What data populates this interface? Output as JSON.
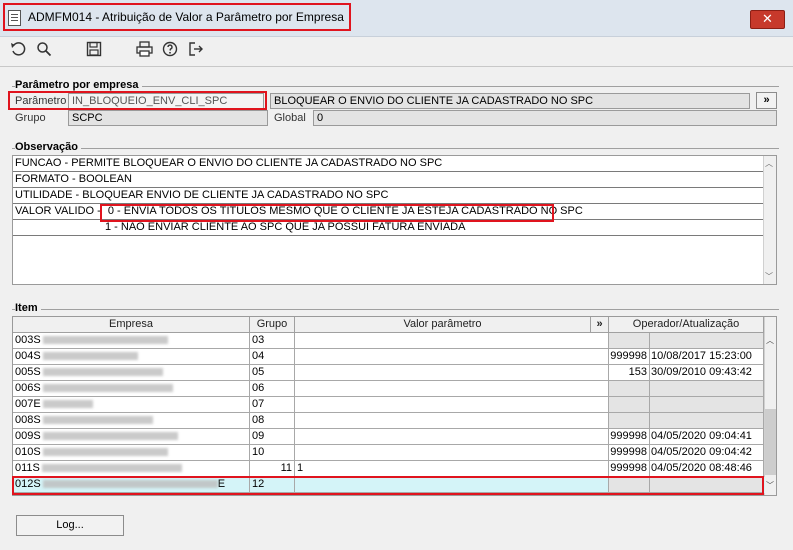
{
  "window": {
    "title": "ADMFM014 - Atribuição de Valor a Parâmetro por Empresa",
    "close_glyph": "✕"
  },
  "toolbar": {
    "icons": [
      "undo-icon",
      "search-icon",
      "save-icon",
      "print-icon",
      "help-icon",
      "exit-icon"
    ]
  },
  "parametro_group": {
    "title": "Parâmetro por empresa",
    "parametro_label": "Parâmetro",
    "parametro_value": "IN_BLOQUEIO_ENV_CLI_SPC",
    "descricao_value": "BLOQUEAR O ENVIO DO CLIENTE JA CADASTRADO NO SPC",
    "more_label": "»",
    "grupo_label": "Grupo",
    "grupo_value": "SCPC",
    "global_label": "Global",
    "global_value": "0"
  },
  "observacao_group": {
    "title": "Observação",
    "lines": [
      "FUNCAO - PERMITE BLOQUEAR O ENVIO DO CLIENTE JA CADASTRADO NO SPC",
      "FORMATO - BOOLEAN",
      "UTILIDADE - BLOQUEAR ENVIO DE CLIENTE JA CADASTRADO NO SPC",
      "VALOR VALIDO -",
      "1 - NAO ENVIAR CLIENTE AO SPC QUE JA POSSUI FATURA ENVIADA"
    ],
    "valor_valido_highlight": "0 - ENVIA TODOS OS TITULOS MESMO QUE O CLIENTE JA ESTEJA CADASTRADO NO SPC"
  },
  "item_group": {
    "title": "Item",
    "columns": {
      "empresa": "Empresa",
      "grupo": "Grupo",
      "valor": "Valor parâmetro",
      "more": "»",
      "operador": "Operador/Atualização"
    },
    "rows": [
      {
        "code": "003",
        "prefix": "S",
        "grupo": "03",
        "valor": "",
        "operador": "",
        "data": ""
      },
      {
        "code": "004",
        "prefix": "S",
        "grupo": "04",
        "valor": "",
        "operador": "999998",
        "data": "10/08/2017 15:23:00"
      },
      {
        "code": "005",
        "prefix": "S",
        "grupo": "05",
        "valor": "",
        "operador": "153",
        "data": "30/09/2010 09:43:42"
      },
      {
        "code": "006",
        "prefix": "S",
        "grupo": "06",
        "valor": "",
        "operador": "",
        "data": ""
      },
      {
        "code": "007",
        "prefix": "E",
        "grupo": "07",
        "valor": "",
        "operador": "",
        "data": ""
      },
      {
        "code": "008",
        "prefix": "S",
        "grupo": "08",
        "valor": "",
        "operador": "",
        "data": ""
      },
      {
        "code": "009",
        "prefix": "S",
        "grupo": "09",
        "valor": "",
        "operador": "999998",
        "data": "04/05/2020 09:04:41"
      },
      {
        "code": "010",
        "prefix": "S",
        "grupo": "10",
        "valor": "",
        "operador": "999998",
        "data": "04/05/2020 09:04:42"
      },
      {
        "code": "011",
        "prefix": "S",
        "grupo": "11",
        "valor": "1",
        "operador": "999998",
        "data": "04/05/2020 08:48:46"
      },
      {
        "code": "012",
        "prefix": "S",
        "suffix": "E",
        "grupo": "12",
        "valor": "",
        "operador": "",
        "data": ""
      }
    ]
  },
  "footer": {
    "log_button": "Log..."
  }
}
